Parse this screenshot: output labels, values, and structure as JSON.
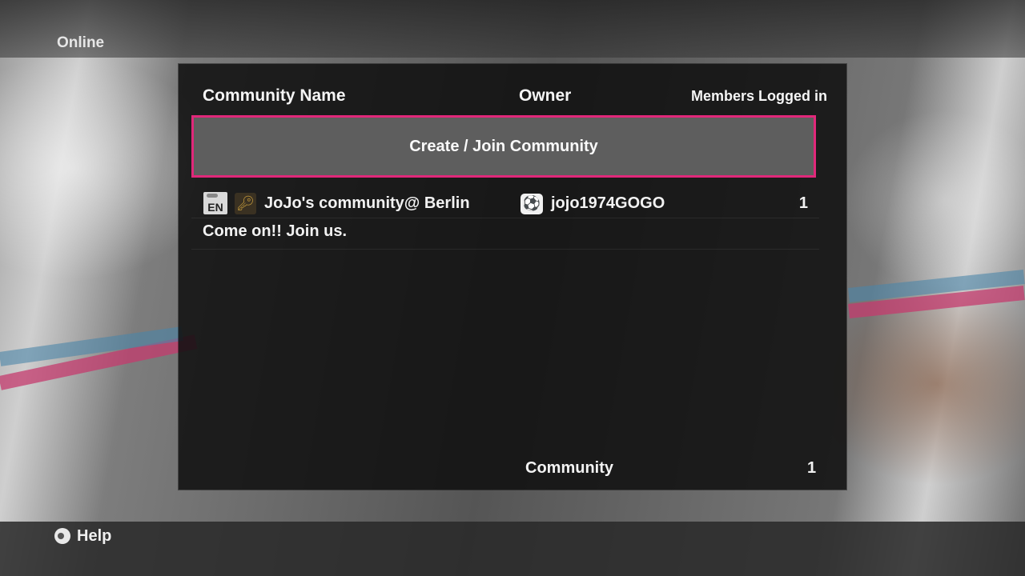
{
  "screen": {
    "title": "Online"
  },
  "table": {
    "headers": {
      "community_name": "Community Name",
      "owner": "Owner",
      "members": "Members Logged in"
    }
  },
  "create_button": {
    "label": "Create / Join Community"
  },
  "communities": [
    {
      "language": "EN",
      "locked_icon": "key-icon",
      "name": "JoJo's community@ Berlin",
      "owner_icon": "football-avatar-icon",
      "owner": "jojo1974GOGO",
      "members_logged_in": "1",
      "comment": "Come on!! Join us."
    }
  ],
  "footer": {
    "label": "Community",
    "count": "1"
  },
  "help": {
    "label": "Help",
    "button_icon": "controller-button-icon"
  },
  "colors": {
    "selection_border": "#e0287a",
    "panel_bg": "#0e0e0e",
    "button_bg": "#5e5e5e"
  }
}
